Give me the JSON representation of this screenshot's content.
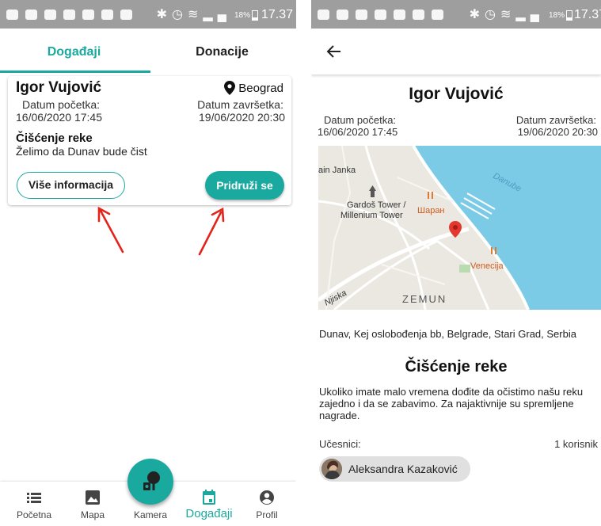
{
  "status_bar": {
    "battery": "18%",
    "time": "17.37"
  },
  "left": {
    "tabs": [
      {
        "label": "Događaji",
        "active": true
      },
      {
        "label": "Donacije",
        "active": false
      }
    ],
    "card": {
      "organizer": "Igor Vujović",
      "city": "Beograd",
      "start_label": "Datum početka:",
      "start_value": "16/06/2020 17:45",
      "end_label": "Datum završetka:",
      "end_value": "19/06/2020 20:30",
      "title": "Čišćenje reke",
      "description": "Želimo da Dunav bude čist",
      "more_info_button": "Više informacija",
      "join_button": "Pridruži se"
    },
    "bottom_nav": [
      {
        "label": "Početna",
        "icon": "list-icon"
      },
      {
        "label": "Mapa",
        "icon": "image-icon"
      },
      {
        "label": "Kamera",
        "icon": "camera-plant-icon"
      },
      {
        "label": "Događaji",
        "icon": "calendar-icon",
        "active": true
      },
      {
        "label": "Profil",
        "icon": "account-icon"
      }
    ],
    "accent_color": "#1aa99e"
  },
  "right": {
    "organizer": "Igor Vujović",
    "start_label": "Datum početka:",
    "start_value": "16/06/2020 17:45",
    "end_label": "Datum završetka:",
    "end_value": "19/06/2020 20:30",
    "map": {
      "labels": {
        "janka": "ain Janka",
        "tower1": "Gardoš Tower /",
        "tower2": "Millenium Tower",
        "sharan": "Шаран",
        "venecija": "Venecija",
        "danube": "Danube",
        "zemun": "ZEMUN",
        "street": "Njiska"
      },
      "water_color": "#7ccbe6"
    },
    "address": "Dunav, Kej oslobođenja bb, Belgrade, Stari Grad, Serbia",
    "title": "Čišćenje reke",
    "description": "Ukoliko imate malo vremena dođite da očistimo našu reku zajedno i da se zabavimo. Za najaktivnije su spremljene nagrade.",
    "participants_label": "Učesnici:",
    "participants_count": "1 korisnik",
    "participants": [
      {
        "name": "Aleksandra Kazaković"
      }
    ]
  }
}
